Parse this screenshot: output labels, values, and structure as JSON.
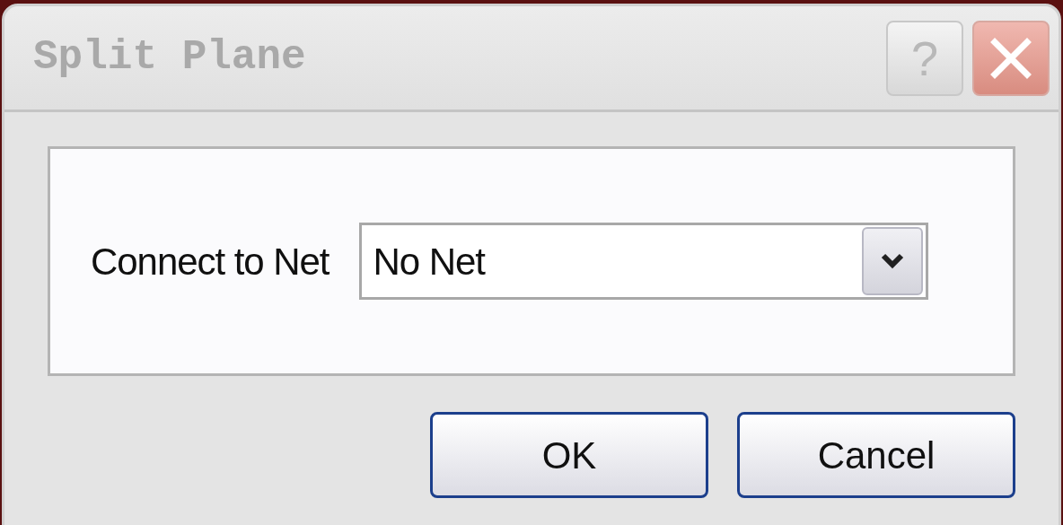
{
  "window": {
    "title": "Split Plane"
  },
  "title_buttons": [
    {
      "kind": "help",
      "label": "?"
    },
    {
      "kind": "close"
    }
  ],
  "field": {
    "label": "Connect to Net",
    "value": "No Net"
  },
  "buttons": [
    "OK",
    "Cancel"
  ]
}
